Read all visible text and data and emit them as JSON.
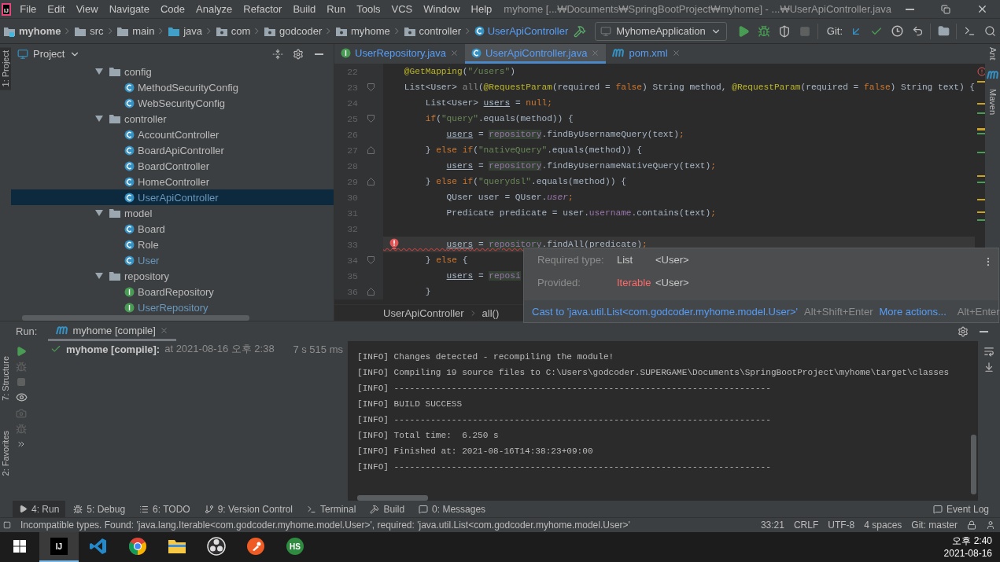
{
  "menu_bar": {
    "logo": "IJ",
    "items": [
      "File",
      "Edit",
      "View",
      "Navigate",
      "Code",
      "Analyze",
      "Refactor",
      "Build",
      "Run",
      "Tools",
      "VCS",
      "Window",
      "Help"
    ],
    "title": "myhome [...₩Documents₩SpringBootProject₩myhome] - ...₩UserApiController.java"
  },
  "navigation": {
    "breadcrumbs": [
      {
        "label": "myhome",
        "kind": "module"
      },
      {
        "label": "src",
        "kind": "folder"
      },
      {
        "label": "main",
        "kind": "folder"
      },
      {
        "label": "java",
        "kind": "source"
      },
      {
        "label": "com",
        "kind": "package"
      },
      {
        "label": "godcoder",
        "kind": "package"
      },
      {
        "label": "myhome",
        "kind": "package"
      },
      {
        "label": "controller",
        "kind": "package"
      },
      {
        "label": "UserApiController",
        "kind": "class"
      }
    ],
    "run_config": "MyhomeApplication",
    "git_label": "Git:"
  },
  "left_stripe": [
    {
      "label": "1: Project",
      "selected": true
    },
    {
      "label": "7: Structure",
      "selected": false
    },
    {
      "label": "2: Favorites",
      "selected": false
    }
  ],
  "project": {
    "title": "Project",
    "tree": [
      {
        "label": "config",
        "kind": "folder",
        "expanded": true,
        "selected": false,
        "modified": false,
        "children": [
          {
            "label": "MethodSecurityConfig",
            "kind": "class",
            "selected": false,
            "modified": false
          },
          {
            "label": "WebSecurityConfig",
            "kind": "class",
            "selected": false,
            "modified": false
          }
        ]
      },
      {
        "label": "controller",
        "kind": "folder",
        "expanded": true,
        "selected": false,
        "modified": false,
        "children": [
          {
            "label": "AccountController",
            "kind": "class",
            "selected": false,
            "modified": false
          },
          {
            "label": "BoardApiController",
            "kind": "class",
            "selected": false,
            "modified": false
          },
          {
            "label": "BoardController",
            "kind": "class",
            "selected": false,
            "modified": false
          },
          {
            "label": "HomeController",
            "kind": "class",
            "selected": false,
            "modified": false
          },
          {
            "label": "UserApiController",
            "kind": "class",
            "selected": true,
            "modified": true
          }
        ]
      },
      {
        "label": "model",
        "kind": "folder",
        "expanded": true,
        "selected": false,
        "modified": false,
        "children": [
          {
            "label": "Board",
            "kind": "class",
            "selected": false,
            "modified": false
          },
          {
            "label": "Role",
            "kind": "class",
            "selected": false,
            "modified": false
          },
          {
            "label": "User",
            "kind": "class",
            "selected": false,
            "modified": true
          }
        ]
      },
      {
        "label": "repository",
        "kind": "folder",
        "expanded": true,
        "selected": false,
        "modified": false,
        "children": [
          {
            "label": "BoardRepository",
            "kind": "interface",
            "selected": false,
            "modified": false
          },
          {
            "label": "UserRepository",
            "kind": "interface",
            "selected": false,
            "modified": true
          }
        ]
      }
    ]
  },
  "editor": {
    "tabs": [
      {
        "label": "UserRepository.java",
        "kind": "interface",
        "selected": false
      },
      {
        "label": "UserApiController.java",
        "kind": "class",
        "selected": true
      },
      {
        "label": "pom.xml",
        "kind": "maven",
        "selected": false
      }
    ],
    "lines": [
      {
        "number": "22",
        "kind": "plain",
        "current": false,
        "error": false,
        "tokens": [
          {
            "text": "    @GetMapping",
            "kind": "annotation"
          },
          {
            "text": "(",
            "kind": "plain"
          },
          {
            "text": "\"/users\"",
            "kind": "string"
          },
          {
            "text": ")",
            "kind": "plain"
          }
        ]
      },
      {
        "number": "23",
        "kind": "fold-start",
        "current": false,
        "error": false,
        "tokens": [
          {
            "text": "    List<User> ",
            "kind": "plain"
          },
          {
            "text": "all",
            "kind": "unused"
          },
          {
            "text": "(",
            "kind": "plain"
          },
          {
            "text": "@RequestParam",
            "kind": "annotation"
          },
          {
            "text": "(required = ",
            "kind": "plain"
          },
          {
            "text": "false",
            "kind": "keyword"
          },
          {
            "text": ") String method, ",
            "kind": "plain"
          },
          {
            "text": "@RequestParam",
            "kind": "annotation"
          },
          {
            "text": "(required = ",
            "kind": "plain"
          },
          {
            "text": "false",
            "kind": "keyword"
          },
          {
            "text": ") String text) {",
            "kind": "plain"
          }
        ]
      },
      {
        "number": "24",
        "kind": "plain",
        "current": false,
        "error": false,
        "tokens": [
          {
            "text": "        List<User> ",
            "kind": "plain"
          },
          {
            "text": "users",
            "kind": "reassigned"
          },
          {
            "text": " = ",
            "kind": "plain"
          },
          {
            "text": "null;",
            "kind": "keyword"
          }
        ]
      },
      {
        "number": "25",
        "kind": "fold-start",
        "current": false,
        "error": false,
        "tokens": [
          {
            "text": "        if",
            "kind": "keyword"
          },
          {
            "text": "(",
            "kind": "plain"
          },
          {
            "text": "\"query\"",
            "kind": "string"
          },
          {
            "text": ".equals(method)) {",
            "kind": "plain"
          }
        ]
      },
      {
        "number": "26",
        "kind": "plain",
        "current": false,
        "error": false,
        "tokens": [
          {
            "text": "            users",
            "kind": "reassigned"
          },
          {
            "text": " = ",
            "kind": "plain"
          },
          {
            "text": "repository",
            "kind": "field"
          },
          {
            "text": ".findByUsernameQuery(text)",
            "kind": "plain"
          },
          {
            "text": ";",
            "kind": "keyword"
          }
        ]
      },
      {
        "number": "27",
        "kind": "fold-end",
        "current": false,
        "error": false,
        "tokens": [
          {
            "text": "        } ",
            "kind": "plain"
          },
          {
            "text": "else if",
            "kind": "keyword"
          },
          {
            "text": "(",
            "kind": "plain"
          },
          {
            "text": "\"nativeQuery\"",
            "kind": "string"
          },
          {
            "text": ".equals(method)) {",
            "kind": "plain"
          }
        ]
      },
      {
        "number": "28",
        "kind": "plain",
        "current": false,
        "error": false,
        "tokens": [
          {
            "text": "            users",
            "kind": "reassigned"
          },
          {
            "text": " = ",
            "kind": "plain"
          },
          {
            "text": "repository",
            "kind": "field"
          },
          {
            "text": ".findByUsernameNativeQuery(text)",
            "kind": "plain"
          },
          {
            "text": ";",
            "kind": "keyword"
          }
        ]
      },
      {
        "number": "29",
        "kind": "fold-end",
        "current": false,
        "error": false,
        "tokens": [
          {
            "text": "        } ",
            "kind": "plain"
          },
          {
            "text": "else if",
            "kind": "keyword"
          },
          {
            "text": "(",
            "kind": "plain"
          },
          {
            "text": "\"querydsl\"",
            "kind": "string"
          },
          {
            "text": ".equals(method)) {",
            "kind": "plain"
          }
        ]
      },
      {
        "number": "30",
        "kind": "plain",
        "current": false,
        "error": false,
        "tokens": [
          {
            "text": "            QUser user = QUser.",
            "kind": "plain"
          },
          {
            "text": "user",
            "kind": "static"
          },
          {
            "text": ";",
            "kind": "keyword"
          }
        ]
      },
      {
        "number": "31",
        "kind": "plain",
        "current": false,
        "error": false,
        "tokens": [
          {
            "text": "            Predicate predicate = user.",
            "kind": "plain"
          },
          {
            "text": "username",
            "kind": "member"
          },
          {
            "text": ".contains(text)",
            "kind": "plain"
          },
          {
            "text": ";",
            "kind": "keyword"
          }
        ]
      },
      {
        "number": "32",
        "kind": "plain",
        "current": false,
        "error": false
      },
      {
        "number": "33",
        "kind": "plain",
        "current": true,
        "error": true,
        "tokens": [
          {
            "text": "            users",
            "kind": "reassigned"
          },
          {
            "text": " = ",
            "kind": "plain"
          },
          {
            "text": "repository",
            "kind": "field"
          },
          {
            "text": ".findAll(predicate)",
            "kind": "plain"
          },
          {
            "text": ";",
            "kind": "keyword"
          }
        ]
      },
      {
        "number": "34",
        "kind": "fold-start",
        "current": false,
        "error": false,
        "tokens": [
          {
            "text": "        } ",
            "kind": "plain"
          },
          {
            "text": "else",
            "kind": "keyword"
          },
          {
            "text": " {",
            "kind": "plain"
          }
        ]
      },
      {
        "number": "35",
        "kind": "plain",
        "current": false,
        "error": false,
        "tokens": [
          {
            "text": "            users",
            "kind": "reassigned"
          },
          {
            "text": " = ",
            "kind": "plain"
          },
          {
            "text": "reposi",
            "kind": "field"
          }
        ]
      },
      {
        "number": "36",
        "kind": "fold-end",
        "current": false,
        "error": false,
        "tokens": [
          {
            "text": "        }",
            "kind": "plain"
          }
        ]
      }
    ],
    "breadcrumbs": [
      "UserApiController",
      "all()"
    ],
    "popup": {
      "required_label": "Required type:",
      "required_type": "List",
      "required_param": "<User>",
      "provided_label": "Provided:",
      "provided_type": "Iterable",
      "provided_param": "<User>",
      "fix": "Cast to 'java.util.List<com.godcoder.myhome.model.User>'",
      "fix_shortcut": "Alt+Shift+Enter",
      "more": "More actions...",
      "more_shortcut": "Alt+Enter"
    }
  },
  "right_stripe": [
    "Ant",
    "Maven"
  ],
  "run": {
    "label": "Run:",
    "tab": "myhome [compile]",
    "task": {
      "name": "myhome [compile]:",
      "detail": "at 2021-08-16 오후 2:38",
      "duration": "7 s 515 ms"
    },
    "console": [
      "[INFO] Changes detected - recompiling the module!",
      "[INFO] Compiling 19 source files to C:\\Users\\godcoder.SUPERGAME\\Documents\\SpringBootProject\\myhome\\target\\classes",
      "[INFO] ------------------------------------------------------------------------",
      "[INFO] BUILD SUCCESS",
      "[INFO] ------------------------------------------------------------------------",
      "[INFO] Total time:  6.250 s",
      "[INFO] Finished at: 2021-08-16T14:38:23+09:00",
      "[INFO] ------------------------------------------------------------------------"
    ]
  },
  "tool_windows": [
    {
      "label": "4: Run",
      "kind": "run",
      "selected": true
    },
    {
      "label": "5: Debug",
      "kind": "debug",
      "selected": false
    },
    {
      "label": "6: TODO",
      "kind": "todo",
      "selected": false
    },
    {
      "label": "9: Version Control",
      "kind": "vcs",
      "selected": false
    },
    {
      "label": "Terminal",
      "kind": "terminal",
      "selected": false
    },
    {
      "label": "Build",
      "kind": "build",
      "selected": false
    },
    {
      "label": "0: Messages",
      "kind": "messages",
      "selected": false
    }
  ],
  "event_log": "Event Log",
  "status_bar": {
    "message": "Incompatible types. Found: 'java.lang.Iterable<com.godcoder.myhome.model.User>', required: 'java.util.List<com.godcoder.myhome.model.User>'",
    "items": [
      "33:21",
      "CRLF",
      "UTF-8",
      "4 spaces",
      "Git: master"
    ]
  },
  "taskbar": {
    "apps": [
      {
        "kind": "intellij",
        "label": "IJ",
        "selected": true
      },
      {
        "kind": "vscode",
        "selected": false
      },
      {
        "kind": "chrome",
        "selected": false
      },
      {
        "kind": "explorer",
        "selected": false
      },
      {
        "kind": "obs",
        "selected": false
      },
      {
        "kind": "postman",
        "selected": false
      },
      {
        "kind": "hs",
        "label": "HS",
        "selected": false
      }
    ],
    "time": "오후 2:40",
    "date": "2021-08-16"
  }
}
